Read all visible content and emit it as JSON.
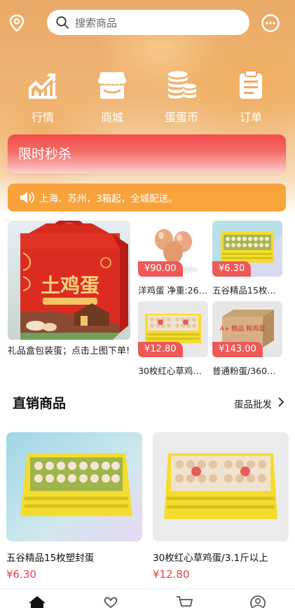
{
  "search": {
    "placeholder": "搜索商品"
  },
  "quick_nav": [
    {
      "label": "行情",
      "icon": "trend-chart-icon"
    },
    {
      "label": "商城",
      "icon": "store-icon"
    },
    {
      "label": "蛋蛋币",
      "icon": "coins-icon"
    },
    {
      "label": "订单",
      "icon": "order-clipboard-icon"
    }
  ],
  "flash_sale": {
    "title": "限时秒杀"
  },
  "notice": {
    "text": "上海、苏州，3箱起，全城配送。"
  },
  "promo": {
    "gift": {
      "box_text": "土鸡蛋",
      "caption": "礼品盒包装蛋；点击上图下单!"
    },
    "tiles": [
      {
        "price": "¥90.00",
        "caption": "洋鸡蛋 净重:26…"
      },
      {
        "price": "¥6.30",
        "caption": "五谷精品15枚…"
      },
      {
        "price": "¥12.80",
        "caption": "30枚红心草鸡…"
      },
      {
        "price": "¥143.00",
        "caption": "普通粉蛋/360…",
        "box_text": "A+ 精品 鲜鸡蛋"
      }
    ]
  },
  "direct_section": {
    "title": "直销商品",
    "more": "蛋品批发"
  },
  "products": [
    {
      "name": "五谷精品15枚塑封蛋",
      "price": "¥6.30"
    },
    {
      "name": "30枚红心草鸡蛋/3.1斤以上",
      "price": "¥12.80"
    }
  ],
  "tabbar": [
    {
      "icon": "home-icon"
    },
    {
      "icon": "heart-hand-icon"
    },
    {
      "icon": "cart-icon"
    },
    {
      "icon": "profile-icon"
    }
  ],
  "colors": {
    "accent": "#f8a33c",
    "price_red": "#e9403f",
    "flash_red": "#f24a4a"
  }
}
